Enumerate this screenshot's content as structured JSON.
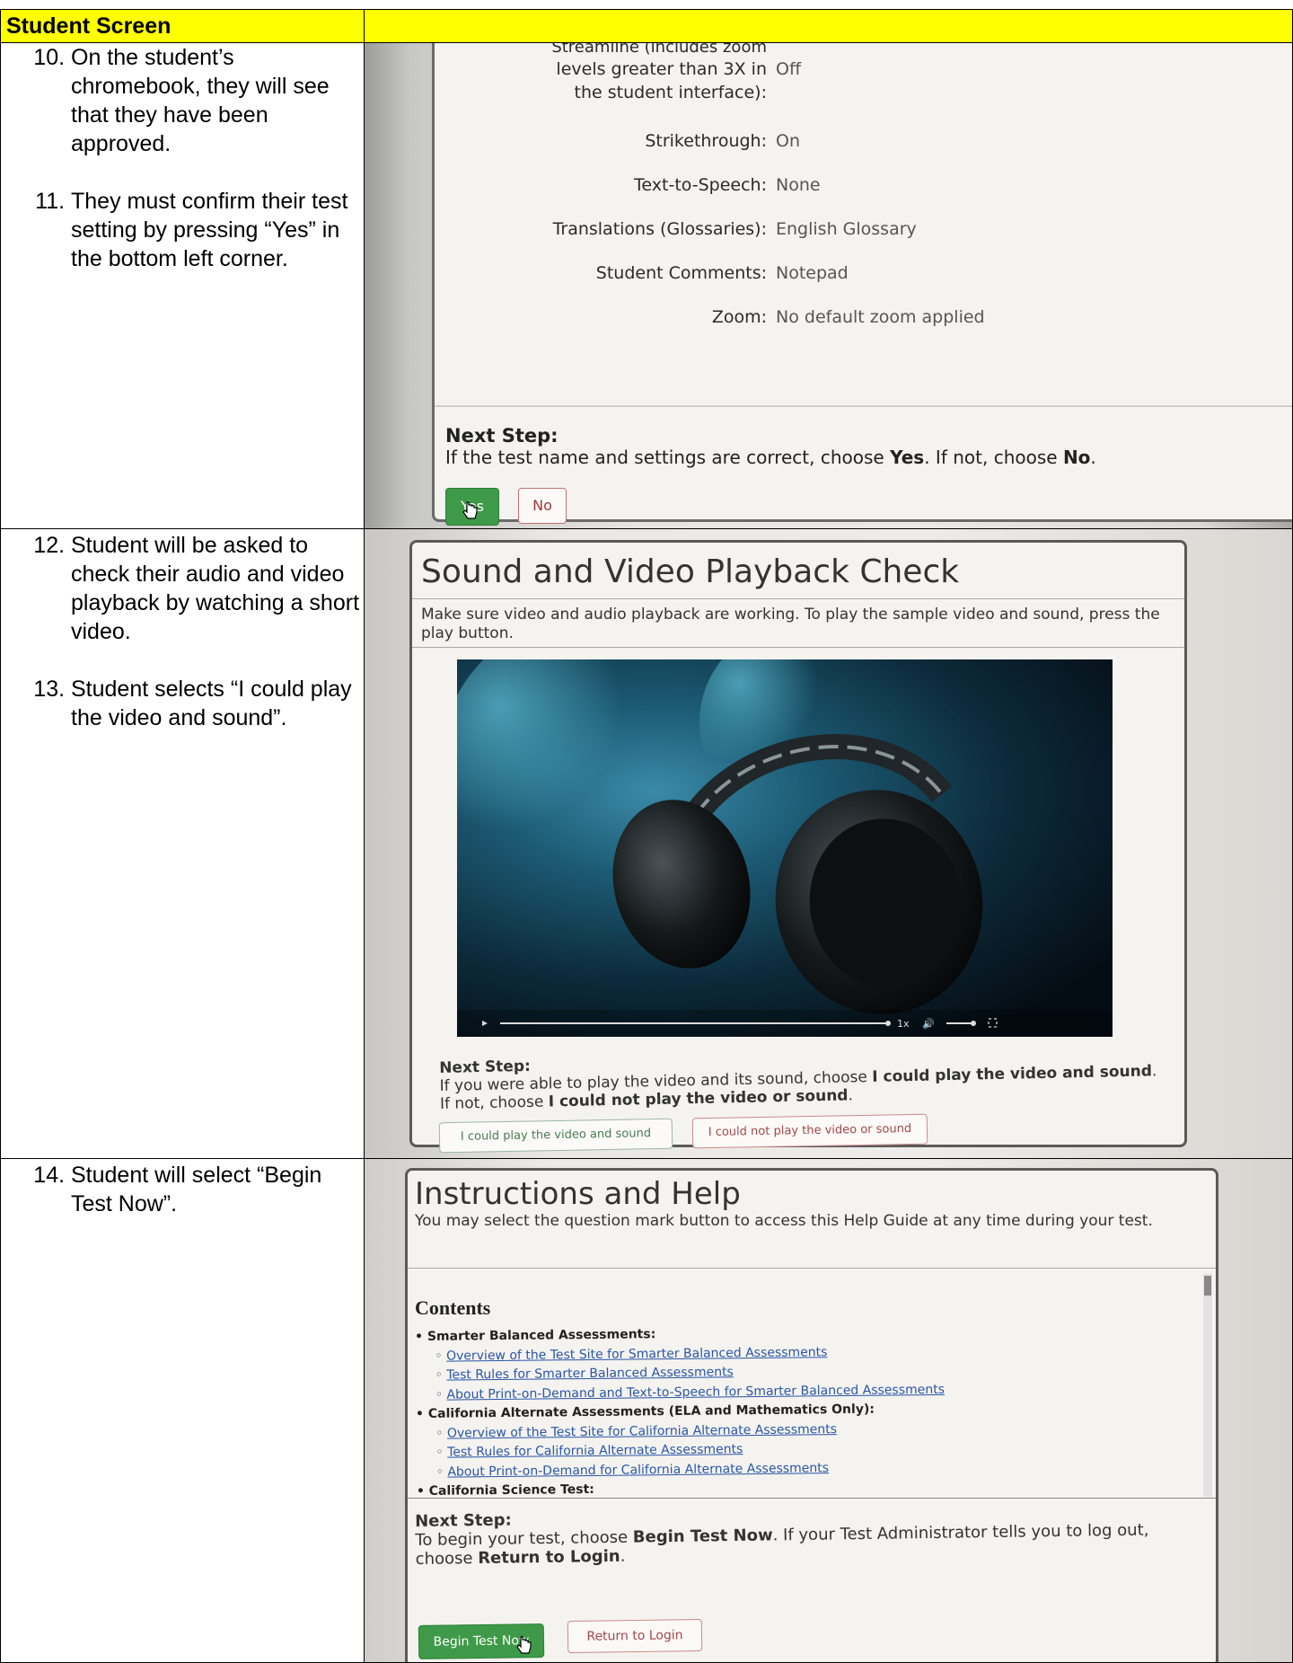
{
  "header": {
    "label": "Student Screen"
  },
  "row1": {
    "steps": [
      "On the student’s chromebook, they will see that they have been approved.",
      "They must confirm their test setting by pressing “Yes” in the bottom left corner."
    ],
    "screen": {
      "settings_partial_label_line1": "Streamline (includes zoom",
      "settings": [
        {
          "label": "levels greater than 3X in the student interface):",
          "value": "Off"
        },
        {
          "label": "Strikethrough:",
          "value": "On"
        },
        {
          "label": "Text-to-Speech:",
          "value": "None"
        },
        {
          "label": "Translations (Glossaries):",
          "value": "English Glossary"
        },
        {
          "label": "Student Comments:",
          "value": "Notepad"
        },
        {
          "label": "Zoom:",
          "value": "No default zoom applied"
        }
      ],
      "next_step_title": "Next Step:",
      "next_step_text_a": "If the test name and settings are correct, choose ",
      "next_step_bold_yes": "Yes",
      "next_step_text_b": ". If not, choose ",
      "next_step_bold_no": "No",
      "next_step_text_c": ".",
      "yes_label": "Yes",
      "no_label": "No"
    }
  },
  "row2": {
    "steps": [
      "Student will be asked to check their audio and video playback by watching a short video.",
      "Student selects “I could play the video and sound”."
    ],
    "screen": {
      "title": "Sound and Video Playback Check",
      "intro": "Make sure video and audio playback are working. To play the sample video and sound, press the play button.",
      "speed_label": "1x",
      "next_step_title": "Next Step:",
      "next_step_text_a": "If you were able to play the video and its sound, choose ",
      "next_step_bold_a": "I could play the video and sound",
      "next_step_text_b": ". If not, choose ",
      "next_step_bold_b": "I could not play the video or sound",
      "next_step_text_c": ".",
      "could_play_label": "I could play the video and sound",
      "could_not_play_label": "I could not play the video or sound"
    }
  },
  "row3": {
    "steps": [
      "Student will select “Begin Test Now”."
    ],
    "screen": {
      "title": "Instructions and Help",
      "intro": "You may select the question mark button to access this Help Guide at any time during your test.",
      "contents_heading": "Contents",
      "toc": [
        {
          "type": "cat",
          "text": "Smarter Balanced Assessments:"
        },
        {
          "type": "lnk",
          "text": "Overview of the Test Site for Smarter Balanced Assessments"
        },
        {
          "type": "lnk",
          "text": "Test Rules for Smarter Balanced Assessments"
        },
        {
          "type": "lnk",
          "text": "About Print-on-Demand and Text-to-Speech for Smarter Balanced Assessments"
        },
        {
          "type": "cat",
          "text": "California Alternate Assessments (ELA and Mathematics Only):"
        },
        {
          "type": "lnk",
          "text": "Overview of the Test Site for California Alternate Assessments"
        },
        {
          "type": "lnk",
          "text": "Test Rules for California Alternate Assessments"
        },
        {
          "type": "lnk",
          "text": "About Print-on-Demand for California Alternate Assessments"
        },
        {
          "type": "cat",
          "text": "California Science Test:"
        }
      ],
      "next_step_title": "Next Step:",
      "next_step_text_a": "To begin your test, choose ",
      "next_step_bold_a": "Begin Test Now",
      "next_step_text_b": ". If your Test Administrator tells you to log out, choose ",
      "next_step_bold_b": "Return to Login",
      "next_step_text_c": ".",
      "begin_label": "Begin Test Now",
      "return_label": "Return to Login"
    }
  }
}
